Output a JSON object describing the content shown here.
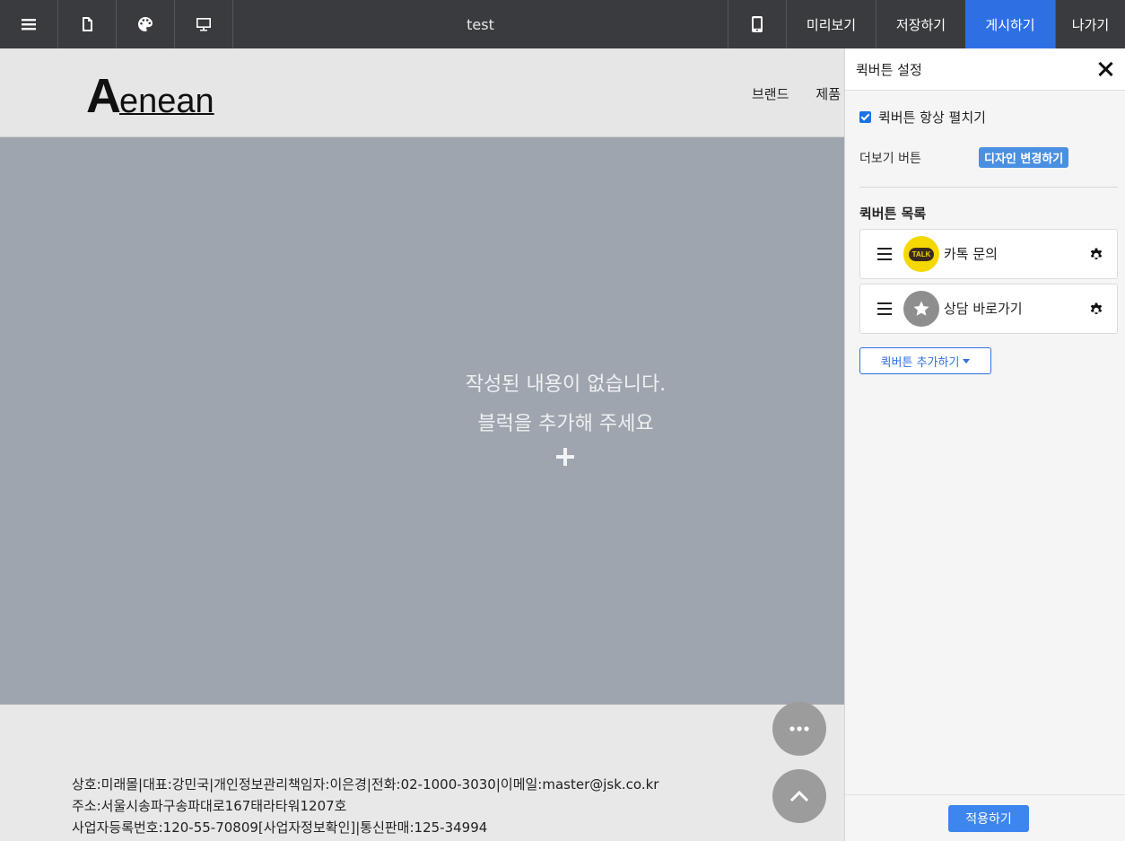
{
  "toolbar": {
    "title": "test",
    "preview_label": "미리보기",
    "save_label": "저장하기",
    "publish_label": "게시하기",
    "exit_label": "나가기",
    "publish_color": "#2f6fe4"
  },
  "site": {
    "logo_big": "A",
    "logo_rest": "enean",
    "nav": [
      "브랜드",
      "제품"
    ]
  },
  "empty": {
    "line1": "작성된 내용이 없습니다.",
    "line2": "블럭을 추가해 주세요"
  },
  "footer": {
    "lines": [
      "상호:미래몰|대표:강민국|개인정보관리책임자:이은경|전화:02-1000-3030|이메일:master@jsk.co.kr",
      "주소:서울시송파구송파대로167태라타워1207호",
      "사업자등록번호:120-55-70809[사업자정보확인]|통신판매:125-34994"
    ]
  },
  "panel": {
    "title": "퀵버튼 설정",
    "always_expand_label": "퀵버튼 항상 펼치기",
    "always_expand_checked": true,
    "more_button_label": "더보기 버튼",
    "design_change_label": "디자인 변경하기",
    "list_title": "퀵버튼 목록",
    "items": [
      {
        "label": "카톡 문의",
        "icon": "kakaotalk-icon",
        "badge": "TALK"
      },
      {
        "label": "상담 바로가기",
        "icon": "star-icon"
      }
    ],
    "add_label": "퀵버튼 추가하기",
    "apply_label": "적용하기"
  }
}
